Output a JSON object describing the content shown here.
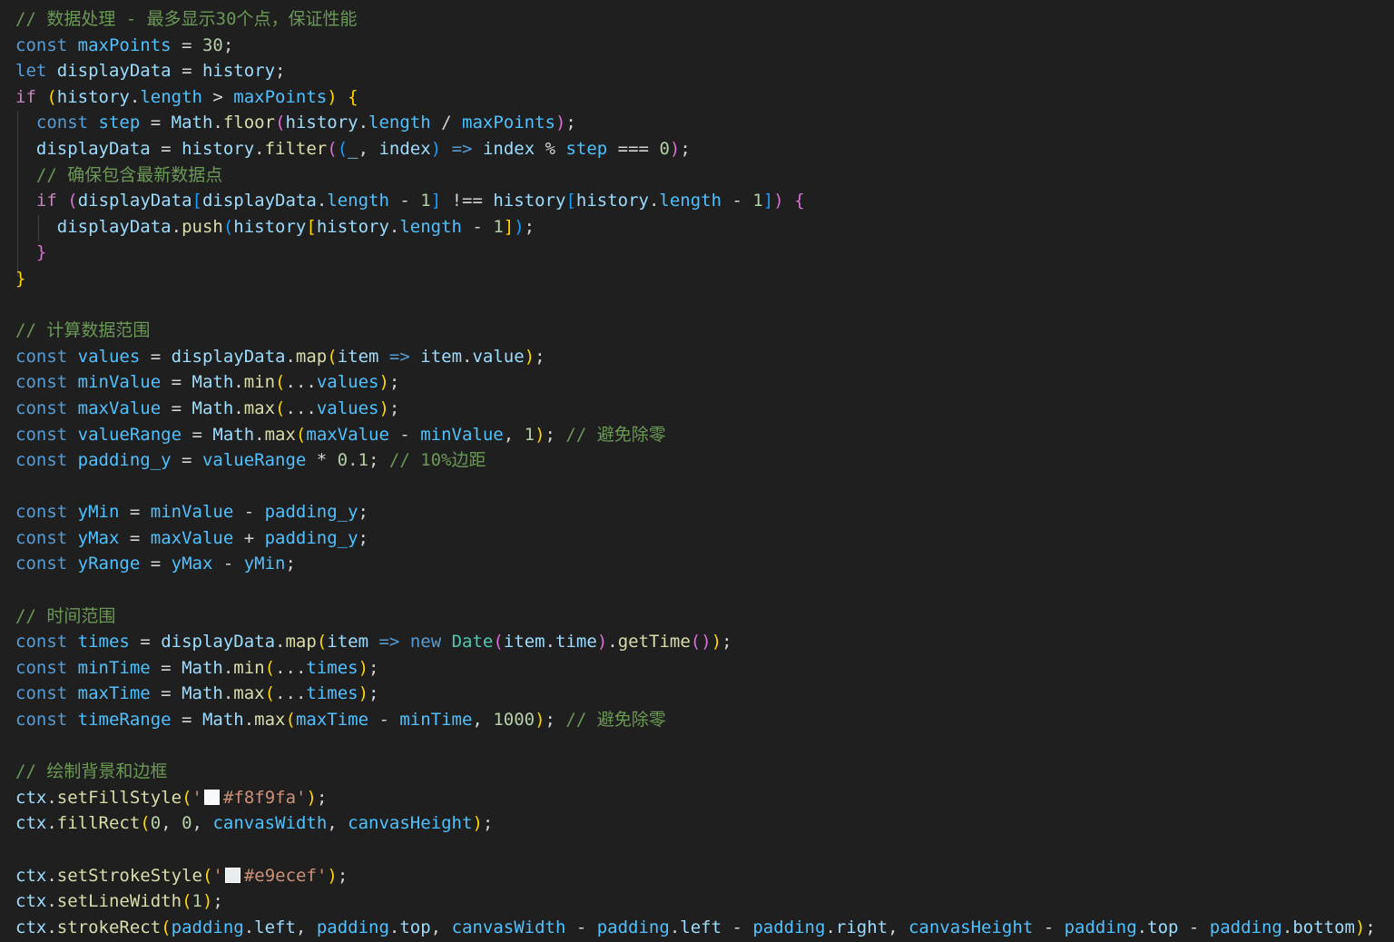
{
  "editor": {
    "language": "javascript",
    "colors": {
      "background": "#1f1f1f",
      "keyword": "#569cd6",
      "control": "#c586c0",
      "constant": "#4fc1ff",
      "identifier": "#9cdcfe",
      "function": "#dcdcaa",
      "number": "#b5cea8",
      "string": "#ce9178",
      "comment": "#6a9955",
      "class": "#4ec9b0",
      "bracket_1": "#ffd700",
      "bracket_2": "#da70d6",
      "bracket_3": "#179fff"
    },
    "color_swatches": [
      "#f8f9fa",
      "#e9ecef"
    ],
    "lines": [
      [
        [
          "c",
          "// 数据处理 - 最多显示30个点，保证性能"
        ]
      ],
      [
        [
          "k",
          "const"
        ],
        [
          "p",
          " "
        ],
        [
          "v",
          "maxPoints"
        ],
        [
          "p",
          " = "
        ],
        [
          "n",
          "30"
        ],
        [
          "p",
          ";"
        ]
      ],
      [
        [
          "k",
          "let"
        ],
        [
          "p",
          " "
        ],
        [
          "i",
          "displayData"
        ],
        [
          "p",
          " = "
        ],
        [
          "i",
          "history"
        ],
        [
          "p",
          ";"
        ]
      ],
      [
        [
          "cf",
          "if"
        ],
        [
          "p",
          " "
        ],
        [
          "b1",
          "("
        ],
        [
          "i",
          "history"
        ],
        [
          "p",
          "."
        ],
        [
          "v",
          "length"
        ],
        [
          "p",
          " > "
        ],
        [
          "v",
          "maxPoints"
        ],
        [
          "b1",
          ")"
        ],
        [
          "p",
          " "
        ],
        [
          "b1",
          "{"
        ]
      ],
      [
        [
          "p",
          "  "
        ],
        [
          "k",
          "const"
        ],
        [
          "p",
          " "
        ],
        [
          "v",
          "step"
        ],
        [
          "p",
          " = "
        ],
        [
          "i",
          "Math"
        ],
        [
          "p",
          "."
        ],
        [
          "f",
          "floor"
        ],
        [
          "b2",
          "("
        ],
        [
          "i",
          "history"
        ],
        [
          "p",
          "."
        ],
        [
          "v",
          "length"
        ],
        [
          "p",
          " / "
        ],
        [
          "v",
          "maxPoints"
        ],
        [
          "b2",
          ")"
        ],
        [
          "p",
          ";"
        ]
      ],
      [
        [
          "p",
          "  "
        ],
        [
          "i",
          "displayData"
        ],
        [
          "p",
          " = "
        ],
        [
          "i",
          "history"
        ],
        [
          "p",
          "."
        ],
        [
          "f",
          "filter"
        ],
        [
          "b2",
          "("
        ],
        [
          "b3",
          "("
        ],
        [
          "i",
          "_"
        ],
        [
          "p",
          ", "
        ],
        [
          "i",
          "index"
        ],
        [
          "b3",
          ")"
        ],
        [
          "p",
          " "
        ],
        [
          "k",
          "=>"
        ],
        [
          "p",
          " "
        ],
        [
          "i",
          "index"
        ],
        [
          "p",
          " % "
        ],
        [
          "v",
          "step"
        ],
        [
          "p",
          " === "
        ],
        [
          "n",
          "0"
        ],
        [
          "b2",
          ")"
        ],
        [
          "p",
          ";"
        ]
      ],
      [
        [
          "p",
          "  "
        ],
        [
          "c",
          "// 确保包含最新数据点"
        ]
      ],
      [
        [
          "p",
          "  "
        ],
        [
          "cf",
          "if"
        ],
        [
          "p",
          " "
        ],
        [
          "b2",
          "("
        ],
        [
          "i",
          "displayData"
        ],
        [
          "b3",
          "["
        ],
        [
          "i",
          "displayData"
        ],
        [
          "p",
          "."
        ],
        [
          "v",
          "length"
        ],
        [
          "p",
          " - "
        ],
        [
          "n",
          "1"
        ],
        [
          "b3",
          "]"
        ],
        [
          "p",
          " !== "
        ],
        [
          "i",
          "history"
        ],
        [
          "b3",
          "["
        ],
        [
          "i",
          "history"
        ],
        [
          "p",
          "."
        ],
        [
          "v",
          "length"
        ],
        [
          "p",
          " - "
        ],
        [
          "n",
          "1"
        ],
        [
          "b3",
          "]"
        ],
        [
          "b2",
          ")"
        ],
        [
          "p",
          " "
        ],
        [
          "b2",
          "{"
        ]
      ],
      [
        [
          "p",
          "    "
        ],
        [
          "i",
          "displayData"
        ],
        [
          "p",
          "."
        ],
        [
          "f",
          "push"
        ],
        [
          "b3",
          "("
        ],
        [
          "i",
          "history"
        ],
        [
          "b1",
          "["
        ],
        [
          "i",
          "history"
        ],
        [
          "p",
          "."
        ],
        [
          "v",
          "length"
        ],
        [
          "p",
          " - "
        ],
        [
          "n",
          "1"
        ],
        [
          "b1",
          "]"
        ],
        [
          "b3",
          ")"
        ],
        [
          "p",
          ";"
        ]
      ],
      [
        [
          "p",
          "  "
        ],
        [
          "b2",
          "}"
        ]
      ],
      [
        [
          "b1",
          "}"
        ]
      ],
      [],
      [
        [
          "c",
          "// 计算数据范围"
        ]
      ],
      [
        [
          "k",
          "const"
        ],
        [
          "p",
          " "
        ],
        [
          "v",
          "values"
        ],
        [
          "p",
          " = "
        ],
        [
          "i",
          "displayData"
        ],
        [
          "p",
          "."
        ],
        [
          "f",
          "map"
        ],
        [
          "b1",
          "("
        ],
        [
          "i",
          "item"
        ],
        [
          "p",
          " "
        ],
        [
          "k",
          "=>"
        ],
        [
          "p",
          " "
        ],
        [
          "i",
          "item"
        ],
        [
          "p",
          "."
        ],
        [
          "i",
          "value"
        ],
        [
          "b1",
          ")"
        ],
        [
          "p",
          ";"
        ]
      ],
      [
        [
          "k",
          "const"
        ],
        [
          "p",
          " "
        ],
        [
          "v",
          "minValue"
        ],
        [
          "p",
          " = "
        ],
        [
          "i",
          "Math"
        ],
        [
          "p",
          "."
        ],
        [
          "f",
          "min"
        ],
        [
          "b1",
          "("
        ],
        [
          "p",
          "..."
        ],
        [
          "v",
          "values"
        ],
        [
          "b1",
          ")"
        ],
        [
          "p",
          ";"
        ]
      ],
      [
        [
          "k",
          "const"
        ],
        [
          "p",
          " "
        ],
        [
          "v",
          "maxValue"
        ],
        [
          "p",
          " = "
        ],
        [
          "i",
          "Math"
        ],
        [
          "p",
          "."
        ],
        [
          "f",
          "max"
        ],
        [
          "b1",
          "("
        ],
        [
          "p",
          "..."
        ],
        [
          "v",
          "values"
        ],
        [
          "b1",
          ")"
        ],
        [
          "p",
          ";"
        ]
      ],
      [
        [
          "k",
          "const"
        ],
        [
          "p",
          " "
        ],
        [
          "v",
          "valueRange"
        ],
        [
          "p",
          " = "
        ],
        [
          "i",
          "Math"
        ],
        [
          "p",
          "."
        ],
        [
          "f",
          "max"
        ],
        [
          "b1",
          "("
        ],
        [
          "v",
          "maxValue"
        ],
        [
          "p",
          " - "
        ],
        [
          "v",
          "minValue"
        ],
        [
          "p",
          ", "
        ],
        [
          "n",
          "1"
        ],
        [
          "b1",
          ")"
        ],
        [
          "p",
          "; "
        ],
        [
          "c",
          "// 避免除零"
        ]
      ],
      [
        [
          "k",
          "const"
        ],
        [
          "p",
          " "
        ],
        [
          "v",
          "padding_y"
        ],
        [
          "p",
          " = "
        ],
        [
          "v",
          "valueRange"
        ],
        [
          "p",
          " * "
        ],
        [
          "n",
          "0.1"
        ],
        [
          "p",
          "; "
        ],
        [
          "c",
          "// 10%边距"
        ]
      ],
      [],
      [
        [
          "k",
          "const"
        ],
        [
          "p",
          " "
        ],
        [
          "v",
          "yMin"
        ],
        [
          "p",
          " = "
        ],
        [
          "v",
          "minValue"
        ],
        [
          "p",
          " - "
        ],
        [
          "v",
          "padding_y"
        ],
        [
          "p",
          ";"
        ]
      ],
      [
        [
          "k",
          "const"
        ],
        [
          "p",
          " "
        ],
        [
          "v",
          "yMax"
        ],
        [
          "p",
          " = "
        ],
        [
          "v",
          "maxValue"
        ],
        [
          "p",
          " + "
        ],
        [
          "v",
          "padding_y"
        ],
        [
          "p",
          ";"
        ]
      ],
      [
        [
          "k",
          "const"
        ],
        [
          "p",
          " "
        ],
        [
          "v",
          "yRange"
        ],
        [
          "p",
          " = "
        ],
        [
          "v",
          "yMax"
        ],
        [
          "p",
          " - "
        ],
        [
          "v",
          "yMin"
        ],
        [
          "p",
          ";"
        ]
      ],
      [],
      [
        [
          "c",
          "// 时间范围"
        ]
      ],
      [
        [
          "k",
          "const"
        ],
        [
          "p",
          " "
        ],
        [
          "v",
          "times"
        ],
        [
          "p",
          " = "
        ],
        [
          "i",
          "displayData"
        ],
        [
          "p",
          "."
        ],
        [
          "f",
          "map"
        ],
        [
          "b1",
          "("
        ],
        [
          "i",
          "item"
        ],
        [
          "p",
          " "
        ],
        [
          "k",
          "=>"
        ],
        [
          "p",
          " "
        ],
        [
          "k",
          "new"
        ],
        [
          "p",
          " "
        ],
        [
          "t",
          "Date"
        ],
        [
          "b2",
          "("
        ],
        [
          "i",
          "item"
        ],
        [
          "p",
          "."
        ],
        [
          "i",
          "time"
        ],
        [
          "b2",
          ")"
        ],
        [
          "p",
          "."
        ],
        [
          "f",
          "getTime"
        ],
        [
          "b2",
          "("
        ],
        [
          "b2",
          ")"
        ],
        [
          "b1",
          ")"
        ],
        [
          "p",
          ";"
        ]
      ],
      [
        [
          "k",
          "const"
        ],
        [
          "p",
          " "
        ],
        [
          "v",
          "minTime"
        ],
        [
          "p",
          " = "
        ],
        [
          "i",
          "Math"
        ],
        [
          "p",
          "."
        ],
        [
          "f",
          "min"
        ],
        [
          "b1",
          "("
        ],
        [
          "p",
          "..."
        ],
        [
          "v",
          "times"
        ],
        [
          "b1",
          ")"
        ],
        [
          "p",
          ";"
        ]
      ],
      [
        [
          "k",
          "const"
        ],
        [
          "p",
          " "
        ],
        [
          "v",
          "maxTime"
        ],
        [
          "p",
          " = "
        ],
        [
          "i",
          "Math"
        ],
        [
          "p",
          "."
        ],
        [
          "f",
          "max"
        ],
        [
          "b1",
          "("
        ],
        [
          "p",
          "..."
        ],
        [
          "v",
          "times"
        ],
        [
          "b1",
          ")"
        ],
        [
          "p",
          ";"
        ]
      ],
      [
        [
          "k",
          "const"
        ],
        [
          "p",
          " "
        ],
        [
          "v",
          "timeRange"
        ],
        [
          "p",
          " = "
        ],
        [
          "i",
          "Math"
        ],
        [
          "p",
          "."
        ],
        [
          "f",
          "max"
        ],
        [
          "b1",
          "("
        ],
        [
          "v",
          "maxTime"
        ],
        [
          "p",
          " - "
        ],
        [
          "v",
          "minTime"
        ],
        [
          "p",
          ", "
        ],
        [
          "n",
          "1000"
        ],
        [
          "b1",
          ")"
        ],
        [
          "p",
          "; "
        ],
        [
          "c",
          "// 避免除零"
        ]
      ],
      [],
      [
        [
          "c",
          "// 绘制背景和边框"
        ]
      ],
      [
        [
          "i",
          "ctx"
        ],
        [
          "p",
          "."
        ],
        [
          "f",
          "setFillStyle"
        ],
        [
          "b1",
          "("
        ],
        [
          "s",
          "'"
        ],
        [
          "swatch",
          "#f8f9fa"
        ],
        [
          "s",
          "#f8f9fa'"
        ],
        [
          "b1",
          ")"
        ],
        [
          "p",
          ";"
        ]
      ],
      [
        [
          "i",
          "ctx"
        ],
        [
          "p",
          "."
        ],
        [
          "f",
          "fillRect"
        ],
        [
          "b1",
          "("
        ],
        [
          "n",
          "0"
        ],
        [
          "p",
          ", "
        ],
        [
          "n",
          "0"
        ],
        [
          "p",
          ", "
        ],
        [
          "v",
          "canvasWidth"
        ],
        [
          "p",
          ", "
        ],
        [
          "v",
          "canvasHeight"
        ],
        [
          "b1",
          ")"
        ],
        [
          "p",
          ";"
        ]
      ],
      [],
      [
        [
          "i",
          "ctx"
        ],
        [
          "p",
          "."
        ],
        [
          "f",
          "setStrokeStyle"
        ],
        [
          "b1",
          "("
        ],
        [
          "s",
          "'"
        ],
        [
          "swatch",
          "#e9ecef"
        ],
        [
          "s",
          "#e9ecef'"
        ],
        [
          "b1",
          ")"
        ],
        [
          "p",
          ";"
        ]
      ],
      [
        [
          "i",
          "ctx"
        ],
        [
          "p",
          "."
        ],
        [
          "f",
          "setLineWidth"
        ],
        [
          "b1",
          "("
        ],
        [
          "n",
          "1"
        ],
        [
          "b1",
          ")"
        ],
        [
          "p",
          ";"
        ]
      ],
      [
        [
          "i",
          "ctx"
        ],
        [
          "p",
          "."
        ],
        [
          "f",
          "strokeRect"
        ],
        [
          "b1",
          "("
        ],
        [
          "v",
          "padding"
        ],
        [
          "p",
          "."
        ],
        [
          "i",
          "left"
        ],
        [
          "p",
          ", "
        ],
        [
          "v",
          "padding"
        ],
        [
          "p",
          "."
        ],
        [
          "i",
          "top"
        ],
        [
          "p",
          ", "
        ],
        [
          "v",
          "canvasWidth"
        ],
        [
          "p",
          " - "
        ],
        [
          "v",
          "padding"
        ],
        [
          "p",
          "."
        ],
        [
          "i",
          "left"
        ],
        [
          "p",
          " - "
        ],
        [
          "v",
          "padding"
        ],
        [
          "p",
          "."
        ],
        [
          "i",
          "right"
        ],
        [
          "p",
          ", "
        ],
        [
          "v",
          "canvasHeight"
        ],
        [
          "p",
          " - "
        ],
        [
          "v",
          "padding"
        ],
        [
          "p",
          "."
        ],
        [
          "i",
          "top"
        ],
        [
          "p",
          " - "
        ],
        [
          "v",
          "padding"
        ],
        [
          "p",
          "."
        ],
        [
          "i",
          "bottom"
        ],
        [
          "b1",
          ")"
        ],
        [
          "p",
          ";"
        ]
      ]
    ]
  }
}
